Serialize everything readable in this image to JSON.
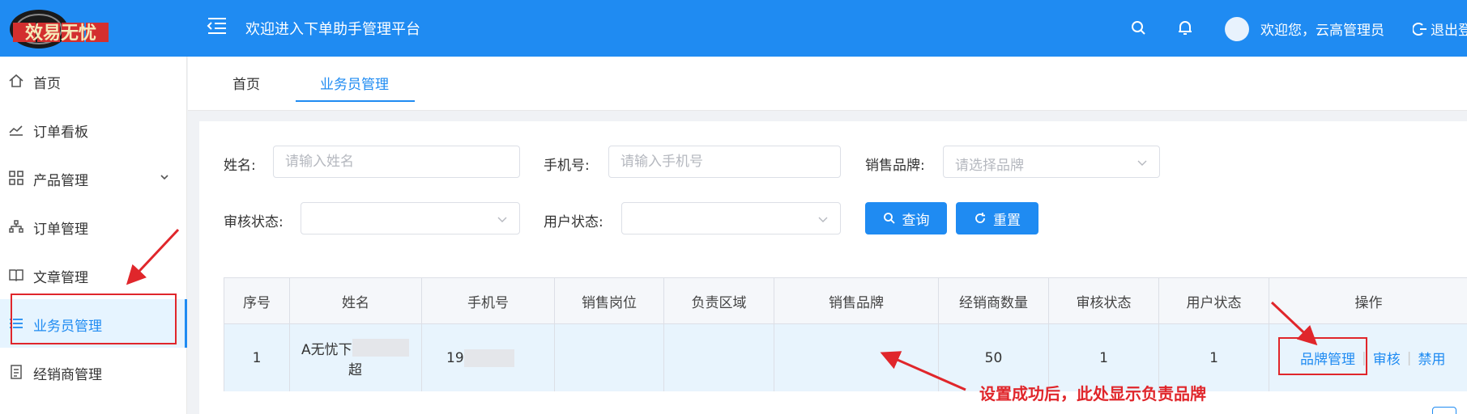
{
  "header": {
    "logo_text": "效易无忧",
    "title": "欢迎进入下单助手管理平台",
    "welcome": "欢迎您，云高管理员",
    "logout_label": "退出登录",
    "bg_color": "#1f8bf2"
  },
  "sidebar": {
    "items": [
      {
        "label": "首页",
        "icon": "home-icon"
      },
      {
        "label": "订单看板",
        "icon": "chart-line-icon"
      },
      {
        "label": "产品管理",
        "icon": "grid-icon"
      },
      {
        "label": "订单管理",
        "icon": "org-chart-icon"
      },
      {
        "label": "文章管理",
        "icon": "book-icon"
      },
      {
        "label": "业务员管理",
        "icon": "list-icon"
      },
      {
        "label": "经销商管理",
        "icon": "document-icon"
      }
    ],
    "active": "业务员管理"
  },
  "tabs": [
    {
      "label": "首页"
    },
    {
      "label": "业务员管理"
    }
  ],
  "filters": {
    "name_label": "姓名:",
    "name_placeholder": "请输入姓名",
    "phone_label": "手机号:",
    "phone_placeholder": "请输入手机号",
    "brand_label": "销售品牌:",
    "brand_placeholder": "请选择品牌",
    "audit_label": "审核状态:",
    "user_status_label": "用户状态:",
    "query_button": "查询",
    "reset_button": "重置"
  },
  "table": {
    "headers": [
      "序号",
      "姓名",
      "手机号",
      "销售岗位",
      "负责区域",
      "销售品牌",
      "经销商数量",
      "审核状态",
      "用户状态",
      "操作"
    ],
    "rows": [
      {
        "index": "1",
        "name_line1": "A无忧下",
        "name_line2": "超",
        "phone": "19",
        "position": "",
        "region": "",
        "brand": "",
        "dealer_count": "50",
        "audit_status": "1",
        "user_status": "1",
        "actions": [
          "品牌管理",
          "审核",
          "禁用"
        ]
      }
    ]
  },
  "annotation": {
    "text": "设置成功后，此处显示负责品牌",
    "color": "#e0262b"
  }
}
